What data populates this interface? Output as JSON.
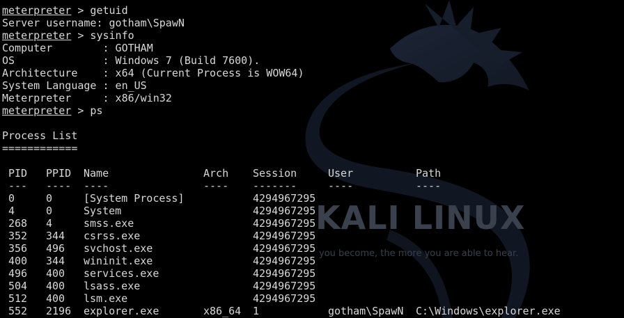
{
  "watermark": {
    "brand": "KALI LINUX",
    "tagline": "you become, the more you are able to hear."
  },
  "prompt": "meterpreter",
  "commands": {
    "getuid": " > getuid",
    "sysinfo": " > sysinfo",
    "ps": " > ps"
  },
  "getuid_output": "Server username: gotham\\SpawN",
  "sysinfo": {
    "computer": "Computer        : GOTHAM",
    "os": "OS              : Windows 7 (Build 7600).",
    "architecture": "Architecture    : x64 (Current Process is WOW64)",
    "language": "System Language : en_US",
    "meterpreter": "Meterpreter     : x86/win32"
  },
  "process_list": {
    "title": "Process List",
    "underline": "============",
    "headers": {
      "pid": "PID",
      "ppid": "PPID",
      "name": "Name",
      "arch": "Arch",
      "session": "Session",
      "user": "User",
      "path": "Path"
    },
    "dashes": {
      "pid": "---",
      "ppid": "----",
      "name": "----",
      "arch": "----",
      "session": "-------",
      "user": "----",
      "path": "----"
    },
    "rows": [
      {
        "pid": "0",
        "ppid": "0",
        "name": "[System Process]",
        "arch": "",
        "session": "4294967295",
        "user": "",
        "path": ""
      },
      {
        "pid": "4",
        "ppid": "0",
        "name": "System",
        "arch": "",
        "session": "4294967295",
        "user": "",
        "path": ""
      },
      {
        "pid": "268",
        "ppid": "4",
        "name": "smss.exe",
        "arch": "",
        "session": "4294967295",
        "user": "",
        "path": ""
      },
      {
        "pid": "352",
        "ppid": "344",
        "name": "csrss.exe",
        "arch": "",
        "session": "4294967295",
        "user": "",
        "path": ""
      },
      {
        "pid": "356",
        "ppid": "496",
        "name": "svchost.exe",
        "arch": "",
        "session": "4294967295",
        "user": "",
        "path": ""
      },
      {
        "pid": "400",
        "ppid": "344",
        "name": "wininit.exe",
        "arch": "",
        "session": "4294967295",
        "user": "",
        "path": ""
      },
      {
        "pid": "496",
        "ppid": "400",
        "name": "services.exe",
        "arch": "",
        "session": "4294967295",
        "user": "",
        "path": ""
      },
      {
        "pid": "504",
        "ppid": "400",
        "name": "lsass.exe",
        "arch": "",
        "session": "4294967295",
        "user": "",
        "path": ""
      },
      {
        "pid": "512",
        "ppid": "400",
        "name": "lsm.exe",
        "arch": "",
        "session": "4294967295",
        "user": "",
        "path": ""
      },
      {
        "pid": "552",
        "ppid": "2196",
        "name": "explorer.exe",
        "arch": "x86_64",
        "session": "1",
        "user": "gotham\\SpawN",
        "path": "C:\\Windows\\explorer.exe"
      }
    ]
  },
  "colors": {
    "background": "#000000",
    "text": "#d8d8d8",
    "dragon": "#1a2233",
    "watermark_text": "#3a414c"
  }
}
